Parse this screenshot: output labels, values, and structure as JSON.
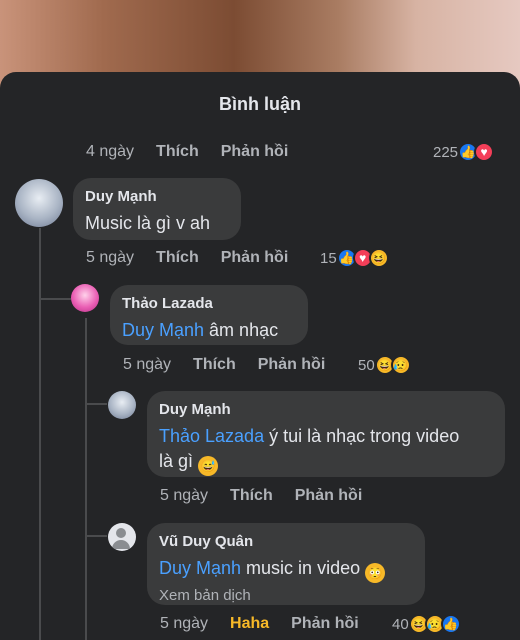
{
  "title": "Bình luận",
  "top_actions": {
    "time": "4 ngày",
    "like": "Thích",
    "reply": "Phản hồi",
    "count": "225"
  },
  "comments": [
    {
      "author": "Duy Mạnh",
      "text": "Music là gì v ah",
      "time": "5 ngày",
      "like": "Thích",
      "reply": "Phản hồi",
      "reaction_count": "15"
    },
    {
      "author": "Thảo Lazada",
      "mention": "Duy Mạnh",
      "text": " âm nhạc",
      "time": "5 ngày",
      "like": "Thích",
      "reply": "Phản hồi",
      "reaction_count": "50"
    },
    {
      "author": "Duy Mạnh",
      "mention": "Thảo Lazada",
      "text": " ý tui là nhạc trong video",
      "text2": "là gì",
      "time": "5 ngày",
      "like": "Thích",
      "reply": "Phản hồi"
    },
    {
      "author": "Vũ Duy Quân",
      "mention": "Duy Mạnh",
      "text": " music in video",
      "translate": "Xem bản dịch",
      "time": "5 ngày",
      "like": "Haha",
      "reply": "Phản hồi",
      "reaction_count": "40"
    }
  ],
  "icons": {
    "like": "thumbs-up",
    "love": "heart",
    "haha": "laughing-face",
    "sad": "sad-face",
    "shocked": "shocked-face",
    "sweat": "sweat-smile-face"
  },
  "colors": {
    "background": "#242527",
    "bubble": "#3a3b3c",
    "mention": "#4aa0ff",
    "haha_active": "#f7b928",
    "like": "#1877f2",
    "love": "#f33e58"
  }
}
